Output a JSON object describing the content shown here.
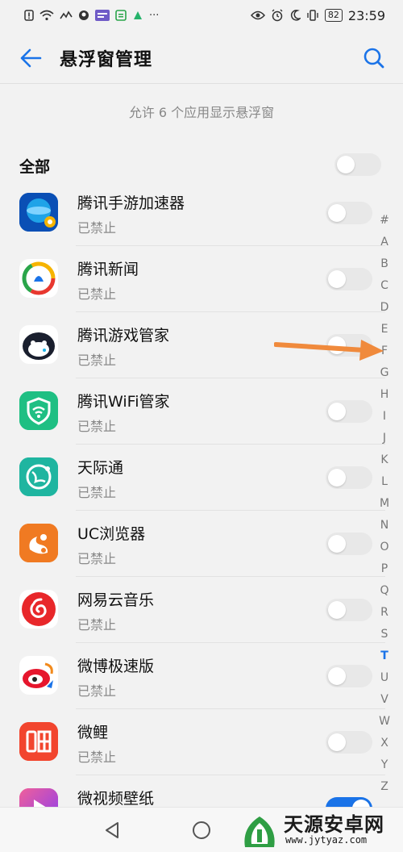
{
  "status_bar": {
    "time": "23:59",
    "battery": "82",
    "left_icons": [
      "alert-icon",
      "wifi-icon",
      "activity-icon",
      "app-notif-icon",
      "news-icon",
      "app-notif-icon-2",
      "music-app-icon"
    ],
    "more": "···"
  },
  "header": {
    "title": "悬浮窗管理"
  },
  "summary": "允许 6 个应用显示悬浮窗",
  "all_toggle": {
    "label": "全部",
    "on": false
  },
  "apps": [
    {
      "name": "腾讯手游加速器",
      "status": "已禁止",
      "on": false,
      "icon": "tencent-game-booster-icon",
      "color": "#0a5ac7"
    },
    {
      "name": "腾讯新闻",
      "status": "已禁止",
      "on": false,
      "icon": "tencent-news-icon",
      "color": "#ffffff"
    },
    {
      "name": "腾讯游戏管家",
      "status": "已禁止",
      "on": false,
      "icon": "tencent-game-manager-icon",
      "color": "#ffffff"
    },
    {
      "name": "腾讯WiFi管家",
      "status": "已禁止",
      "on": false,
      "icon": "tencent-wifi-manager-icon",
      "color": "#1fbf83"
    },
    {
      "name": "天际通",
      "status": "已禁止",
      "on": false,
      "icon": "tianjitong-icon",
      "color": "#1fb5a0"
    },
    {
      "name": "UC浏览器",
      "status": "已禁止",
      "on": false,
      "icon": "uc-browser-icon",
      "color": "#f07a22"
    },
    {
      "name": "网易云音乐",
      "status": "已禁止",
      "on": false,
      "icon": "netease-music-icon",
      "color": "#ffffff"
    },
    {
      "name": "微博极速版",
      "status": "已禁止",
      "on": false,
      "icon": "weibo-lite-icon",
      "color": "#ffffff"
    },
    {
      "name": "微鲤",
      "status": "已禁止",
      "on": false,
      "icon": "weili-icon",
      "color": "#f2452e"
    },
    {
      "name": "微视频壁纸",
      "status": "",
      "on": true,
      "icon": "video-wallpaper-icon",
      "color": "#e8358a"
    }
  ],
  "alphabet": [
    "#",
    "A",
    "B",
    "C",
    "D",
    "E",
    "F",
    "G",
    "H",
    "I",
    "J",
    "K",
    "L",
    "M",
    "N",
    "O",
    "P",
    "Q",
    "R",
    "S",
    "T",
    "U",
    "V",
    "W",
    "X",
    "Y",
    "Z"
  ],
  "alphabet_active": "T",
  "nav": [
    "back-nav-icon",
    "home-nav-icon"
  ],
  "watermark": {
    "title": "天源安卓网",
    "url": "www.jytyaz.com"
  },
  "colors": {
    "accent": "#1a73e8",
    "arrow": "#f08a3c"
  }
}
